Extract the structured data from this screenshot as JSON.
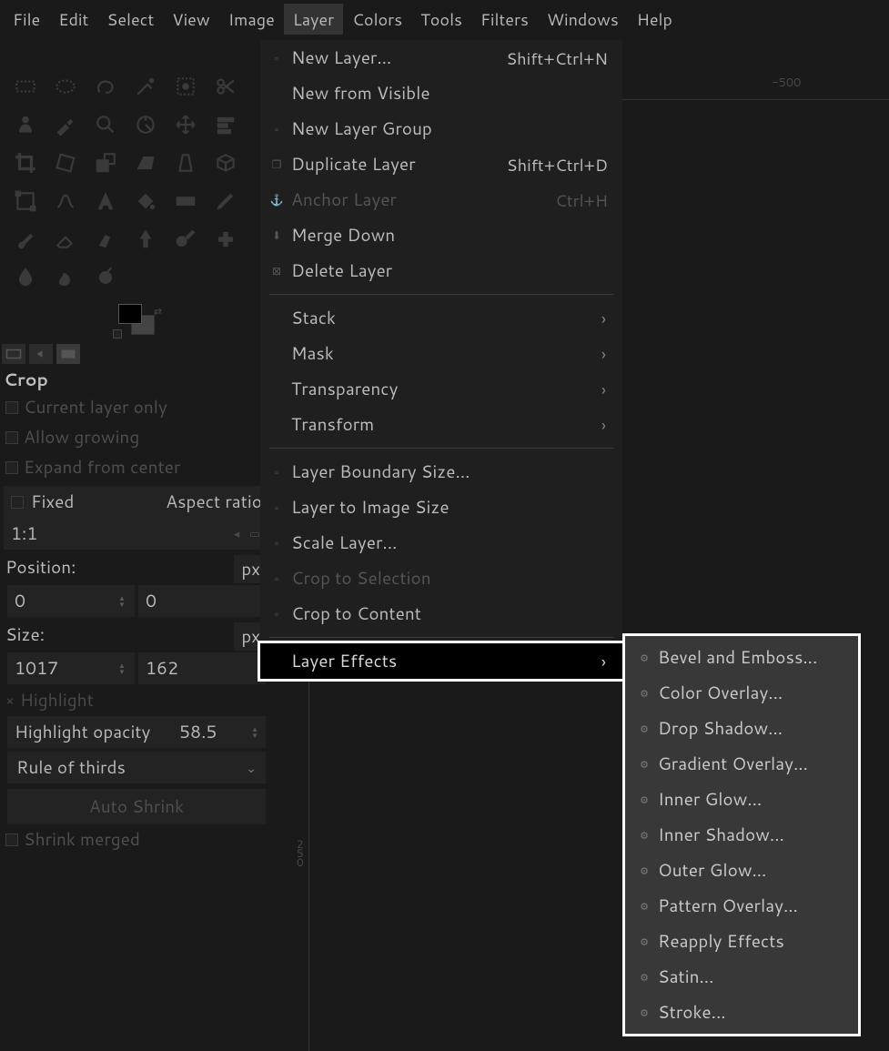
{
  "menubar": [
    "File",
    "Edit",
    "Select",
    "View",
    "Image",
    "Layer",
    "Colors",
    "Tools",
    "Filters",
    "Windows",
    "Help"
  ],
  "menubar_active": "Layer",
  "tool_options": {
    "title": "Crop",
    "checks": [
      "Current layer only",
      "Allow growing",
      "Expand from center"
    ],
    "fixed_label": "Fixed",
    "fixed_mode": "Aspect ratio",
    "ratio_value": "1:1",
    "position_label": "Position:",
    "position_unit": "px",
    "position_x": "0",
    "position_y": "0",
    "size_label": "Size:",
    "size_unit": "px",
    "size_w": "1017",
    "size_h": "162",
    "highlight_label": "Highlight",
    "highlight_opacity_label": "Highlight opacity",
    "highlight_opacity_value": "58.5",
    "guides_mode": "Rule of thirds",
    "auto_shrink": "Auto Shrink",
    "shrink_merged": "Shrink merged"
  },
  "ruler": {
    "h_label": "-500",
    "v_label": "250"
  },
  "layer_menu": [
    {
      "label": "New Layer...",
      "accel": "Shift+Ctrl+N",
      "icon": "sq"
    },
    {
      "label": "New from Visible"
    },
    {
      "label": "New Layer Group",
      "icon": "sq"
    },
    {
      "label": "Duplicate Layer",
      "accel": "Shift+Ctrl+D",
      "icon": "dup"
    },
    {
      "label": "Anchor Layer",
      "accel": "Ctrl+H",
      "icon": "anchor",
      "disabled": true
    },
    {
      "label": "Merge Down",
      "icon": "merge"
    },
    {
      "label": "Delete Layer",
      "icon": "x"
    },
    {
      "sep": true
    },
    {
      "label": "Stack",
      "submenu": true
    },
    {
      "label": "Mask",
      "submenu": true
    },
    {
      "label": "Transparency",
      "submenu": true
    },
    {
      "label": "Transform",
      "submenu": true
    },
    {
      "sep": true
    },
    {
      "label": "Layer Boundary Size...",
      "icon": "sq"
    },
    {
      "label": "Layer to Image Size",
      "icon": "sq"
    },
    {
      "label": "Scale Layer...",
      "icon": "sq"
    },
    {
      "label": "Crop to Selection",
      "icon": "sq",
      "disabled": true
    },
    {
      "label": "Crop to Content",
      "icon": "sq"
    },
    {
      "sep": true
    },
    {
      "label": "Layer Effects",
      "submenu": true,
      "hover": true
    }
  ],
  "layer_effects": [
    "Bevel and Emboss...",
    "Color Overlay...",
    "Drop Shadow...",
    "Gradient Overlay...",
    "Inner Glow...",
    "Inner Shadow...",
    "Outer Glow...",
    "Pattern Overlay...",
    "Reapply Effects",
    "Satin...",
    "Stroke..."
  ]
}
